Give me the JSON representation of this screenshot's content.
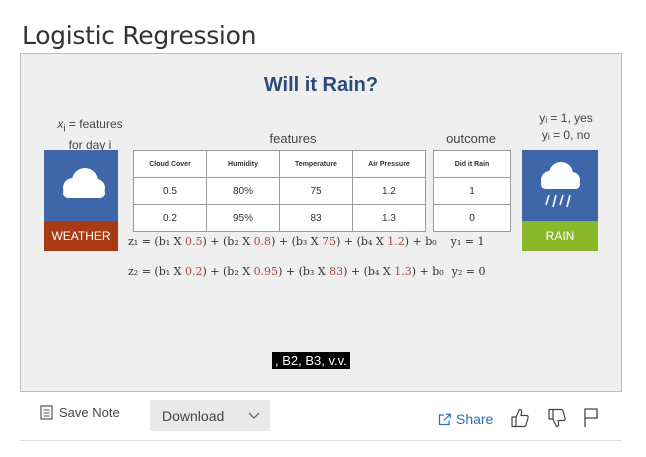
{
  "page": {
    "title": "Logistic Regression"
  },
  "slide": {
    "title": "Will it Rain?",
    "left_note_line1": "x",
    "left_note_sub": "i",
    "left_note_line1_rest": " = features",
    "left_note_line2": "for day i",
    "right_note_line1": "yᵢ = 1, yes",
    "right_note_line2": "yᵢ = 0, no",
    "features_label": "features",
    "outcome_label": "outcome",
    "weather_label": "WEATHER",
    "rain_label": "RAIN",
    "features_table": {
      "headers": [
        "Cloud Cover",
        "Humidity",
        "Temperature",
        "Air Pressure"
      ],
      "rows": [
        [
          "0.5",
          "80%",
          "75",
          "1.2"
        ],
        [
          "0.2",
          "95%",
          "83",
          "1.3"
        ]
      ]
    },
    "outcome_table": {
      "header": "Did it Rain",
      "rows": [
        "1",
        "0"
      ]
    },
    "equation_1": {
      "lhs": "z₁ = (b₁ X ",
      "v1": "0.5",
      "p2": ") + (b₂ X ",
      "v2": "0.8",
      "p3": ") + (b₃ X ",
      "v3": "75",
      "p4": ") + (b₄ X ",
      "v4": "1.2",
      "tail": ") + b₀",
      "y": "y₁ = 1"
    },
    "equation_2": {
      "lhs": "z₂ = (b₁ X ",
      "v1": "0.2",
      "p2": ") + (b₂ X ",
      "v2": "0.95",
      "p3": ") + (b₃ X ",
      "v3": "83",
      "p4": ") + (b₄ X ",
      "v4": "1.3",
      "tail": ") + b₀",
      "y": "y₂ = 0"
    },
    "caption": ", B2, B3, v.v."
  },
  "toolbar": {
    "save_note": "Save Note",
    "download": "Download",
    "share": "Share"
  },
  "icons": {
    "save": "note-icon",
    "chevron": "chevron-down-icon",
    "share": "share-icon",
    "like": "thumbs-up-icon",
    "dislike": "thumbs-down-icon",
    "flag": "flag-icon",
    "cloud": "cloud-icon",
    "rain": "rain-cloud-icon"
  },
  "colors": {
    "weather_card": "#a83a14",
    "rain_card": "#8ab82a",
    "card_blue": "#3f66a8",
    "slide_title": "#2a4a7a",
    "link": "#2a6ebb"
  }
}
